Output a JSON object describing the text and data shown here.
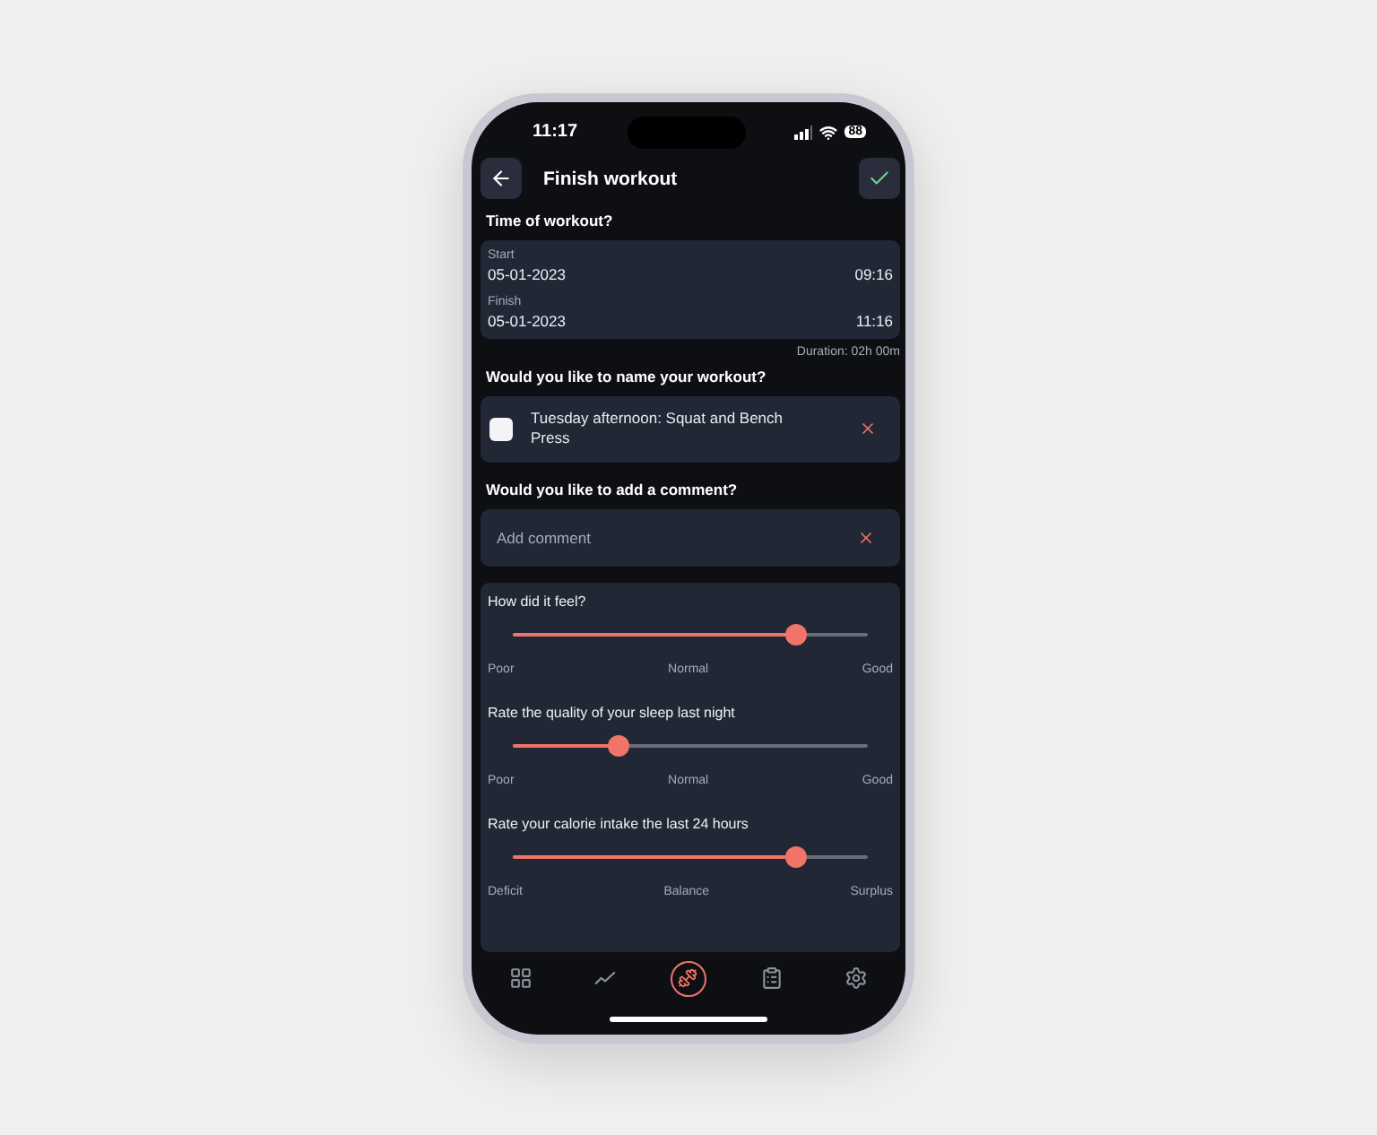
{
  "status_bar": {
    "time": "11:17",
    "battery": "88"
  },
  "header": {
    "title": "Finish workout"
  },
  "time_section": {
    "label": "Time of workout?",
    "rows": [
      {
        "label": "Start",
        "date": "05-01-2023",
        "time": "09:16"
      },
      {
        "label": "Finish",
        "date": "05-01-2023",
        "time": "11:16"
      }
    ],
    "duration": "Duration: 02h 00m"
  },
  "name_section": {
    "label": "Would you like to name your workout?",
    "checked": false,
    "value": "Tuesday afternoon: Squat and Bench Press"
  },
  "comment_section": {
    "label": "Would you like to add a comment?",
    "placeholder": "Add comment"
  },
  "ratings": [
    {
      "question": "How did it feel?",
      "level": 0.8,
      "scale": [
        "Poor",
        "Normal",
        "Good"
      ]
    },
    {
      "question": "Rate the quality of your sleep last night",
      "level": 0.3,
      "scale": [
        "Poor",
        "Normal",
        "Good"
      ]
    },
    {
      "question": "Rate your calorie intake the last 24 hours",
      "level": 0.8,
      "scale": [
        "Deficit",
        "Balance",
        "Surplus"
      ]
    }
  ],
  "nav": [
    {
      "kind": "dashboard",
      "selected": false
    },
    {
      "kind": "progress",
      "selected": false
    },
    {
      "kind": "workout",
      "selected": true
    },
    {
      "kind": "log",
      "selected": false
    },
    {
      "kind": "settings",
      "selected": false
    }
  ]
}
